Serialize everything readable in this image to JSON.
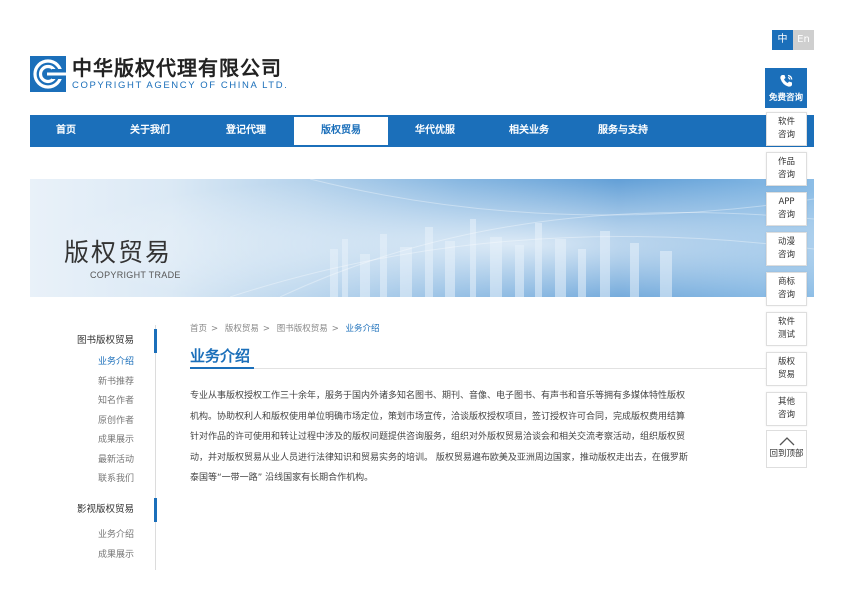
{
  "lang": {
    "zh": "中",
    "en": "En"
  },
  "logo": {
    "cn": "中华版权代理有限公司",
    "en": "COPYRIGHT AGENCY OF CHINA LTD.",
    "color": "#1b6fba"
  },
  "nav": [
    "首页",
    "关于我们",
    "登记代理",
    "版权贸易",
    "华代优服",
    "相关业务",
    "服务与支持"
  ],
  "nav_active": 3,
  "banner": {
    "title": "版权贸易",
    "subtitle": "COPYRIGHT TRADE"
  },
  "sidebar": {
    "groups": [
      {
        "head": "图书版权贸易",
        "items": [
          "业务介绍",
          "新书推荐",
          "知名作者",
          "原创作者",
          "成果展示",
          "最新活动",
          "联系我们"
        ]
      },
      {
        "head": "影视版权贸易",
        "items": [
          "业务介绍",
          "成果展示"
        ]
      }
    ]
  },
  "breadcrumb": [
    "首页",
    "版权贸易",
    "图书版权贸易",
    "业务介绍"
  ],
  "content": {
    "title": "业务介绍",
    "lines": [
      "专业从事版权授权工作三十余年，服务于国内外诸多知名图书、期刊、音像、电子图书、有声书和音乐等拥有多媒体特性版权",
      "机构。协助权利人和版权使用单位明确市场定位，策划市场宣传，洽谈版权授权项目，签订授权许可合同，完成版权费用结算",
      "针对作品的许可使用和转让过程中涉及的版权问题提供咨询服务，组织对外版权贸易洽谈会和相关交流考察活动，组织版权贸",
      "动，并对版权贸易从业人员进行法律知识和贸易实务的培训。 版权贸易遍布欧美及亚洲周边国家，推动版权走出去，在俄罗斯",
      "泰国等“一带一路” 沿线国家有长期合作机构。"
    ]
  },
  "consult": {
    "top": "免费咨询",
    "items": [
      [
        "软件",
        "咨询"
      ],
      [
        "作品",
        "咨询"
      ],
      [
        "APP",
        "咨询"
      ],
      [
        "动漫",
        "咨询"
      ],
      [
        "商标",
        "咨询"
      ],
      [
        "软件",
        "测试"
      ],
      [
        "版权",
        "贸易"
      ],
      [
        "其他",
        "咨询"
      ]
    ],
    "back_top": "回到顶部"
  }
}
